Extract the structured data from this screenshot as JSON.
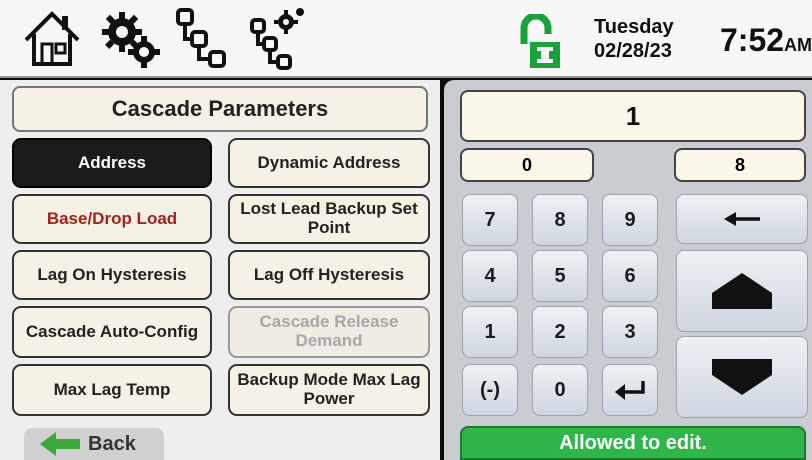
{
  "header": {
    "icons": [
      "home-icon",
      "settings-gears-icon",
      "network-icon",
      "network-settings-icon",
      "lock-icon"
    ],
    "day": "Tuesday",
    "date": "02/28/23",
    "time": "7:52",
    "ampm": "AM",
    "colors": {
      "lock_green": "#1aa13a"
    }
  },
  "page": {
    "title": "Cascade Parameters"
  },
  "params": [
    {
      "label": "Address",
      "state": "selected"
    },
    {
      "label": "Dynamic Address",
      "state": "normal"
    },
    {
      "label": "Base/Drop Load",
      "state": "highlight"
    },
    {
      "label": "Lost Lead Backup Set Point",
      "state": "normal"
    },
    {
      "label": "Lag On Hysteresis",
      "state": "normal"
    },
    {
      "label": "Lag Off Hysteresis",
      "state": "normal"
    },
    {
      "label": "Cascade Auto-Config",
      "state": "normal"
    },
    {
      "label": "Cascade Release Demand",
      "state": "disabled"
    },
    {
      "label": "Max Lag Temp",
      "state": "normal"
    },
    {
      "label": "Backup Mode Max Lag Power",
      "state": "normal"
    }
  ],
  "back": {
    "label": "Back",
    "arrow_color": "#3aa83a"
  },
  "keypad": {
    "display_value": "1",
    "min": "0",
    "max": "8",
    "keys": [
      "7",
      "8",
      "9",
      "4",
      "5",
      "6",
      "1",
      "2",
      "3",
      "(-)",
      "0",
      "enter-icon"
    ],
    "backspace": "backspace-arrow-icon",
    "up": "up-arrow-icon",
    "down": "down-arrow-icon"
  },
  "status": {
    "text": "Allowed to edit.",
    "color": "#2fb54a"
  }
}
